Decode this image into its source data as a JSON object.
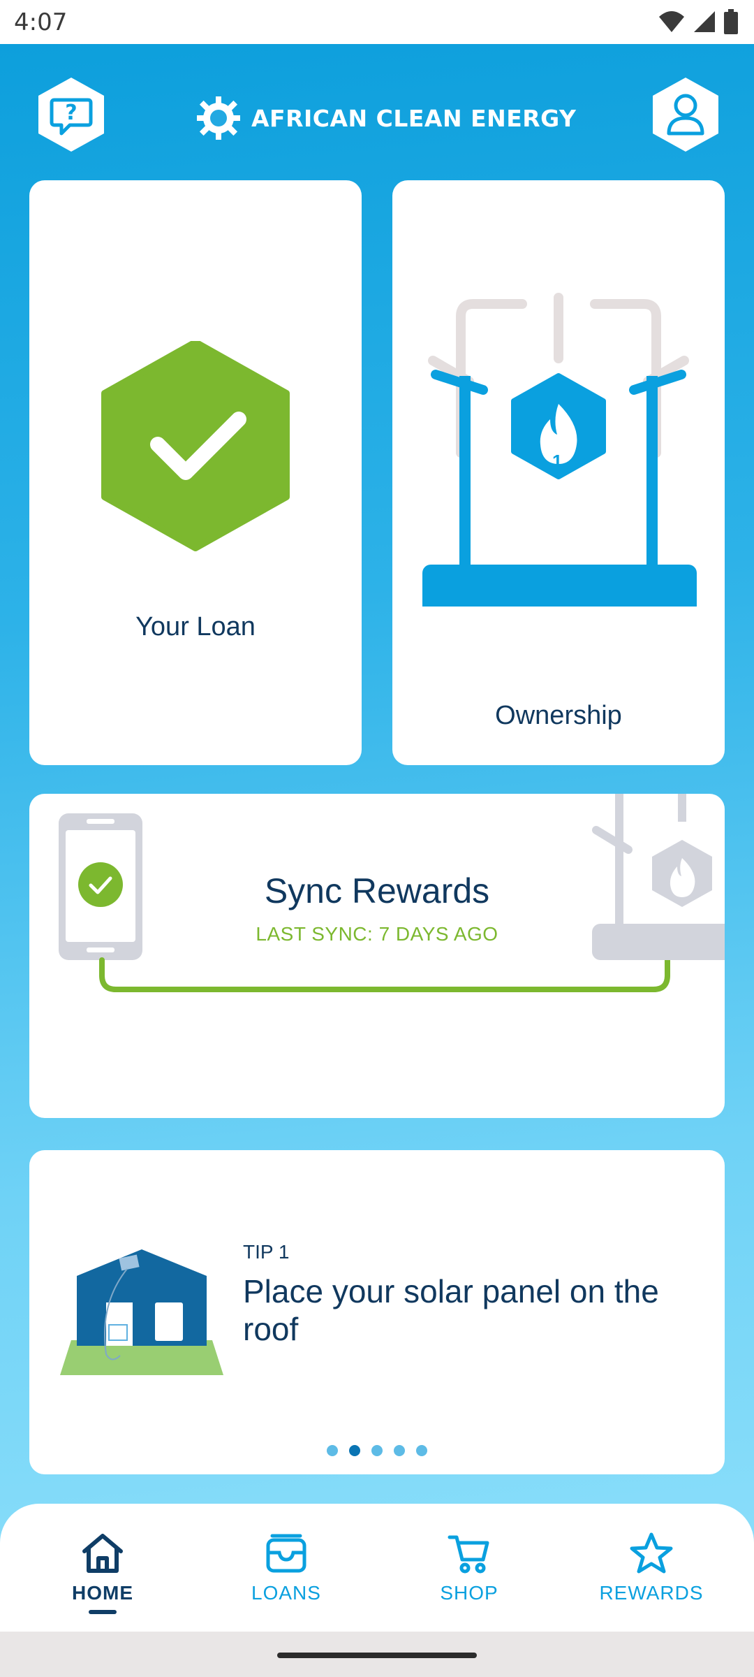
{
  "status_bar": {
    "time": "4:07"
  },
  "header": {
    "brand": "AFRICAN CLEAN ENERGY"
  },
  "cards": {
    "loan": {
      "label": "Your Loan"
    },
    "ownership": {
      "label": "Ownership",
      "stove_number": "1"
    },
    "sync": {
      "title": "Sync Rewards",
      "subtitle": "LAST SYNC: 7 DAYS AGO"
    },
    "tip": {
      "kicker": "TIP 1",
      "text": "Place your solar panel on the roof",
      "active_dot": 2,
      "dot_count": 5
    }
  },
  "bottom_nav": [
    {
      "label": "HOME",
      "icon": "home-icon",
      "active": true
    },
    {
      "label": "LOANS",
      "icon": "wallet-icon",
      "active": false
    },
    {
      "label": "SHOP",
      "icon": "cart-icon",
      "active": false
    },
    {
      "label": "REWARDS",
      "icon": "star-icon",
      "active": false
    }
  ],
  "colors": {
    "brand_blue": "#0aa0df",
    "navy": "#10385e",
    "green": "#7cb82f",
    "background_gradient_start": "#0d9fdc",
    "background_gradient_end": "#8fe0fb"
  }
}
